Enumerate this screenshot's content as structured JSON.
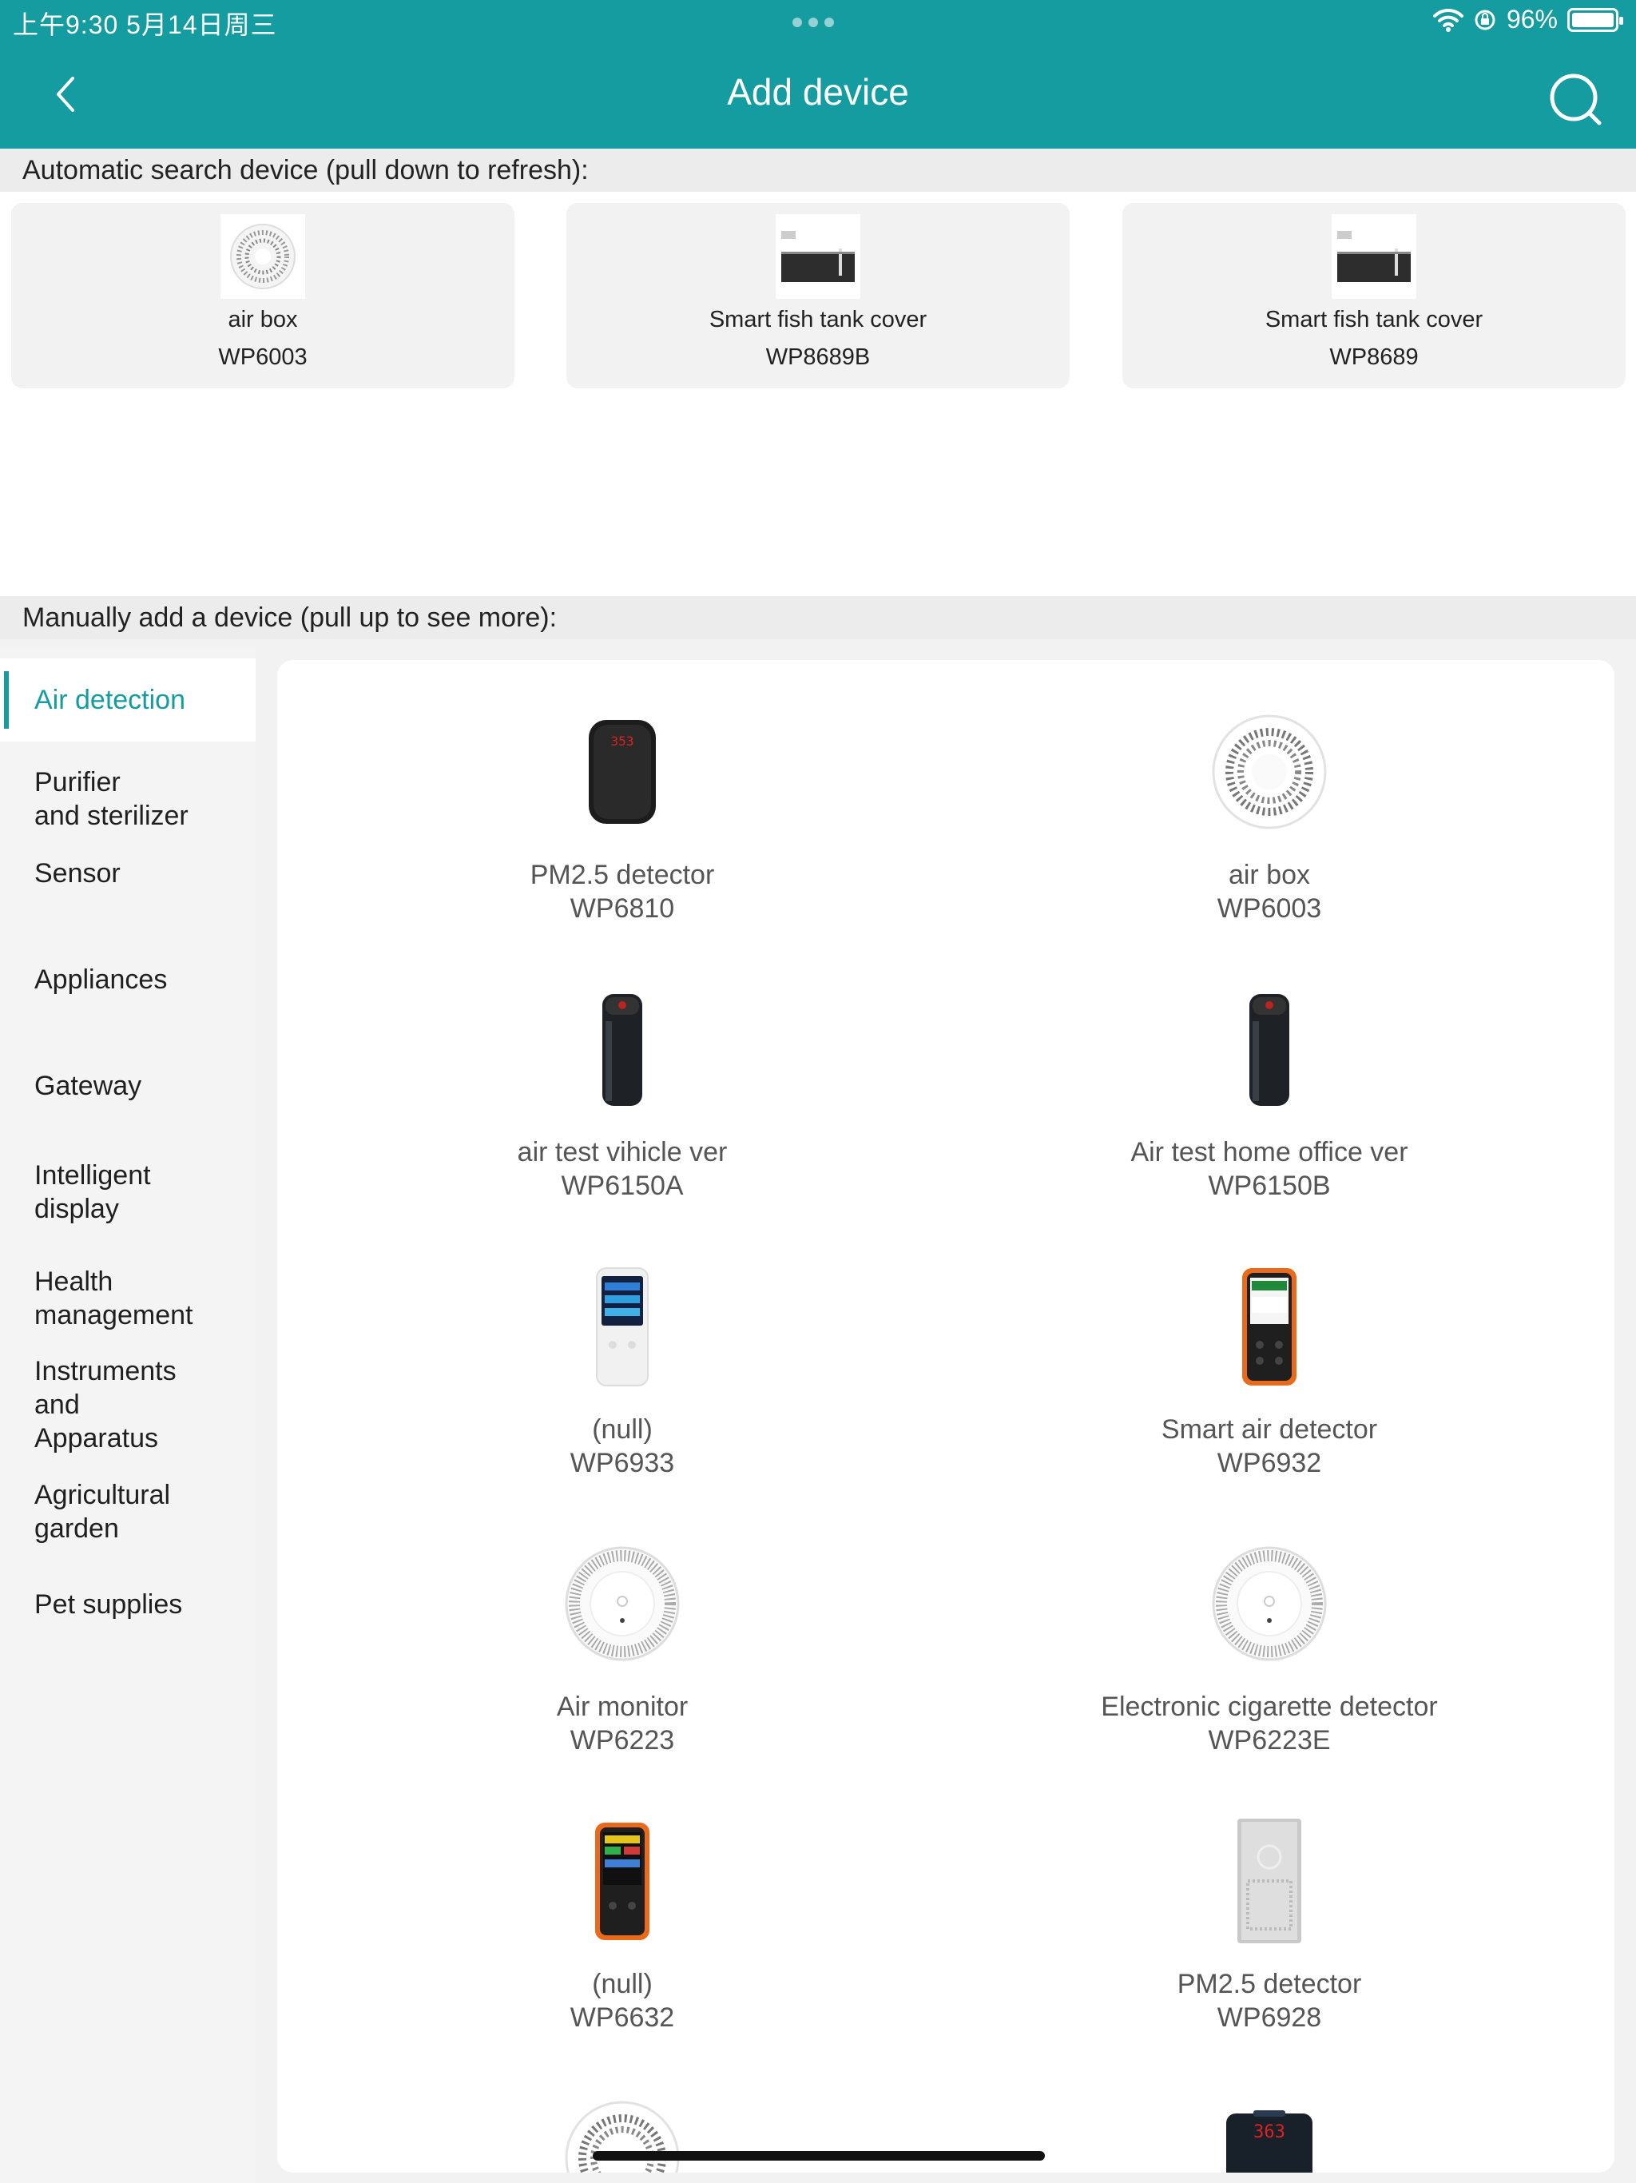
{
  "status_bar": {
    "time_date": "上午9:30   5月14日周三",
    "battery_pct": "96%"
  },
  "header": {
    "title": "Add device"
  },
  "auto_search": {
    "heading": "Automatic search device (pull down to refresh):",
    "devices": [
      {
        "name": "air box",
        "model": "WP6003"
      },
      {
        "name": "Smart fish tank cover",
        "model": "WP8689B"
      },
      {
        "name": "Smart fish tank cover",
        "model": "WP8689"
      }
    ]
  },
  "manual": {
    "heading": "Manually add a device (pull up to see more):",
    "categories": [
      {
        "label": "Air detection"
      },
      {
        "label": "Purifier\nand sterilizer"
      },
      {
        "label": "Sensor"
      },
      {
        "label": "Appliances"
      },
      {
        "label": "Gateway"
      },
      {
        "label": "Intelligent\ndisplay"
      },
      {
        "label": "Health\nmanagement"
      },
      {
        "label": "Instruments\nand\nApparatus"
      },
      {
        "label": "Agricultural\ngarden"
      },
      {
        "label": "Pet supplies"
      }
    ],
    "devices": [
      {
        "name": "PM2.5 detector",
        "model": "WP6810",
        "icon": "black-pm-detector-icon"
      },
      {
        "name": "air box",
        "model": "WP6003",
        "icon": "round-airbox-icon"
      },
      {
        "name": "air test vihicle ver",
        "model": "WP6150A",
        "icon": "cylinder-tester-icon"
      },
      {
        "name": "Air test home office ver",
        "model": "WP6150B",
        "icon": "cylinder-tester-icon"
      },
      {
        "name": "(null)",
        "model": "WP6933",
        "icon": "white-handheld-detector-icon"
      },
      {
        "name": "Smart air detector",
        "model": "WP6932",
        "icon": "orange-handheld-detector-icon"
      },
      {
        "name": "Air monitor",
        "model": "WP6223",
        "icon": "round-monitor-icon"
      },
      {
        "name": "Electronic cigarette detector",
        "model": "WP6223E",
        "icon": "round-monitor-icon"
      },
      {
        "name": "(null)",
        "model": "WP6632",
        "icon": "orange-handheld-detector-icon"
      },
      {
        "name": "PM2.5 detector",
        "model": "WP6928",
        "icon": "grey-panel-detector-icon"
      }
    ],
    "partial_reading": "363"
  }
}
